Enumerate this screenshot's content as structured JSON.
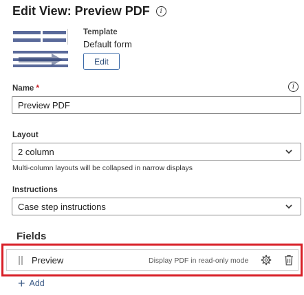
{
  "header": {
    "title": "Edit View: Preview PDF",
    "info_icon": "info-icon"
  },
  "template": {
    "label": "Template",
    "value": "Default form",
    "edit_label": "Edit"
  },
  "name": {
    "label": "Name",
    "required_mark": "*",
    "value": "Preview PDF",
    "info_icon": "info-icon"
  },
  "layout": {
    "label": "Layout",
    "value": "2 column",
    "help": "Multi-column layouts will be collapsed in narrow displays"
  },
  "instructions": {
    "label": "Instructions",
    "value": "Case step instructions"
  },
  "fields": {
    "heading": "Fields",
    "items": [
      {
        "name": "Preview",
        "description": "Display PDF in read-only mode",
        "settings_icon": "gear-icon",
        "delete_icon": "trash-icon"
      }
    ],
    "add_label": "Add",
    "highlight_color": "#d81e26"
  }
}
